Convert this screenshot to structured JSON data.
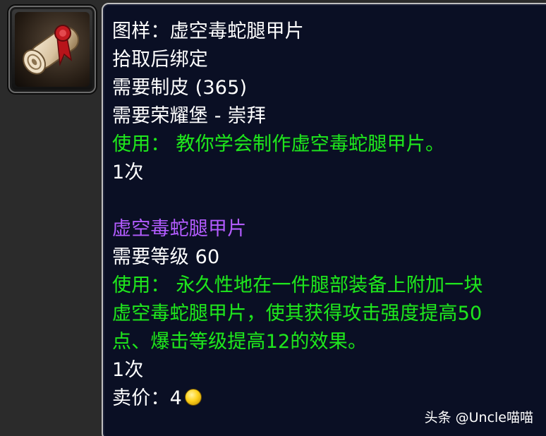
{
  "item": {
    "icon": "scroll-pattern-icon",
    "lines": [
      "图样：虚空毒蛇腿甲片",
      "拾取后绑定",
      "需要制皮 (365)",
      "需要荣耀堡 - 崇拜",
      "使用：  教你学会制作虚空毒蛇腿甲片。",
      "1次",
      "虚空毒蛇腿甲片",
      "需要等级 60",
      "使用：  永久性地在一件腿部装备上附加一块",
      "虚空毒蛇腿甲片，使其获得攻击强度提高50",
      "点、爆击等级提高12的效果。",
      "1次",
      "卖价：4"
    ],
    "sell_currency_icon": "gold-coin-icon"
  },
  "watermark": "头条 @Uncle喵喵",
  "colors": {
    "tooltip_bg": "#0a0f24",
    "text_white": "#ffffff",
    "text_green": "#1fe51f",
    "text_purple": "#b35cff",
    "border": "#bfbfbf"
  }
}
